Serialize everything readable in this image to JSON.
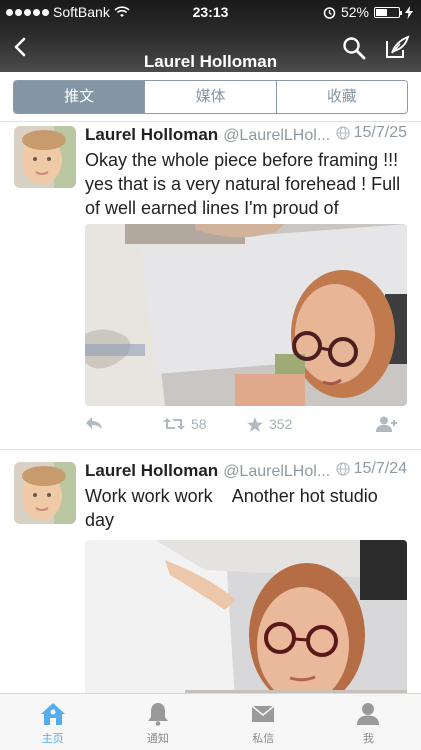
{
  "status_bar": {
    "carrier": "SoftBank",
    "time": "23:13",
    "battery_percent": "52%",
    "battery_level": 0.52
  },
  "nav": {
    "title": "Laurel Holloman"
  },
  "segments": [
    {
      "label": "推文",
      "active": true
    },
    {
      "label": "媒体",
      "active": false
    },
    {
      "label": "收藏",
      "active": false
    }
  ],
  "tweets": [
    {
      "name": "Laurel Holloman",
      "handle": "@LaurelLHol...",
      "date": "15/7/25",
      "text": "Okay the whole piece before framing !!! yes that is a very natural forehead ! Full of well earned lines I'm proud of",
      "retweets": "58",
      "favorites": "352"
    },
    {
      "name": "Laurel Holloman",
      "handle": "@LaurelLHol...",
      "date": "15/7/24",
      "text": "Work work work    Another hot studio day"
    }
  ],
  "tabbar": [
    {
      "label": "主页",
      "icon": "home-icon",
      "active": true
    },
    {
      "label": "通知",
      "icon": "bell-icon",
      "active": false
    },
    {
      "label": "私信",
      "icon": "envelope-icon",
      "active": false
    },
    {
      "label": "我",
      "icon": "person-icon",
      "active": false
    }
  ],
  "colors": {
    "accent": "#55acee",
    "segment_active": "#8496a6",
    "muted": "#8f9aa3"
  }
}
